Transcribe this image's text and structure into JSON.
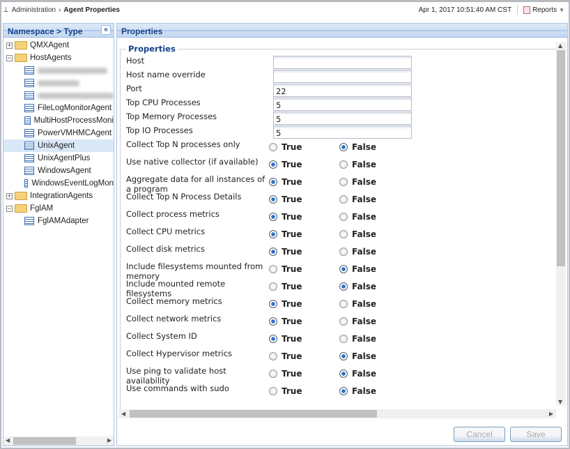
{
  "breadcrumb": {
    "parent": "Administration",
    "current": "Agent Properties"
  },
  "timestamp": "Apr 1, 2017 10:51:40 AM CST",
  "reports_label": "Reports",
  "left_panel": {
    "title": "Namespace > Type",
    "collapse_icon": "double-chevron-left-icon",
    "tree": [
      {
        "label": "QMXAgent",
        "type": "folder",
        "expanded": false
      },
      {
        "label": "HostAgents",
        "type": "folder",
        "expanded": true,
        "children": [
          {
            "label": "",
            "blurred": true
          },
          {
            "label": "",
            "blurred": true
          },
          {
            "label": "",
            "blurred": true
          },
          {
            "label": "FileLogMonitorAgent"
          },
          {
            "label": "MultiHostProcessMoni"
          },
          {
            "label": "PowerVMHMCAgent"
          },
          {
            "label": "UnixAgent",
            "selected": true
          },
          {
            "label": "UnixAgentPlus"
          },
          {
            "label": "WindowsAgent"
          },
          {
            "label": "WindowsEventLogMon"
          }
        ]
      },
      {
        "label": "IntegrationAgents",
        "type": "folder",
        "expanded": false
      },
      {
        "label": "FglAM",
        "type": "folder",
        "expanded": true,
        "children": [
          {
            "label": "FglAMAdapter"
          }
        ]
      }
    ]
  },
  "right_panel": {
    "title": "Properties",
    "fieldset_legend": "Properties",
    "text_fields": [
      {
        "label": "Host",
        "value": ""
      },
      {
        "label": "Host name override",
        "value": ""
      },
      {
        "label": "Port",
        "value": "22"
      },
      {
        "label": "Top CPU Processes",
        "value": "5"
      },
      {
        "label": "Top Memory Processes",
        "value": "5"
      },
      {
        "label": "Top IO Processes",
        "value": "5"
      }
    ],
    "true_label": "True",
    "false_label": "False",
    "radio_fields": [
      {
        "label": "Collect Top N processes only",
        "value": false
      },
      {
        "label": "Use native collector (if available)",
        "value": true
      },
      {
        "label": "Aggregate data for all instances of a program",
        "value": true
      },
      {
        "label": "Collect Top N Process Details",
        "value": true
      },
      {
        "label": "Collect process metrics",
        "value": true
      },
      {
        "label": "Collect CPU metrics",
        "value": true
      },
      {
        "label": "Collect disk metrics",
        "value": true
      },
      {
        "label": "Include filesystems mounted from memory",
        "value": false
      },
      {
        "label": "Include mounted remote filesystems",
        "value": false
      },
      {
        "label": "Collect memory metrics",
        "value": true
      },
      {
        "label": "Collect network metrics",
        "value": true
      },
      {
        "label": "Collect System ID",
        "value": true
      },
      {
        "label": "Collect Hypervisor metrics",
        "value": false
      },
      {
        "label": "Use ping to validate host availability",
        "value": false
      },
      {
        "label": "Use commands with sudo",
        "value": false
      }
    ]
  },
  "buttons": {
    "cancel": "Cancel",
    "save": "Save",
    "disabled": true
  },
  "colors": {
    "header_text": "#15428b",
    "panel_border": "#99bbe8",
    "selected_row": "#d9e8f7"
  }
}
